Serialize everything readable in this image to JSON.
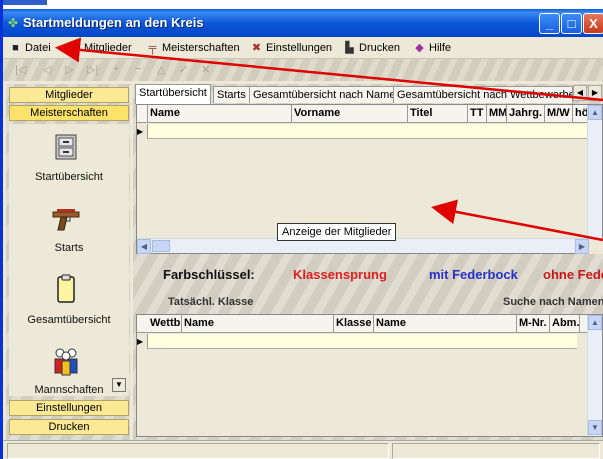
{
  "window": {
    "title": "Startmeldungen an den Kreis",
    "controls": {
      "minimize": "_",
      "maximize": "□",
      "close": "X"
    }
  },
  "menu": {
    "items": [
      {
        "label": "Datei",
        "icon": "floppy-icon"
      },
      {
        "label": "Mitglieder",
        "icon": "person-icon"
      },
      {
        "label": "Meisterschaften",
        "icon": "rifle-icon"
      },
      {
        "label": "Einstellungen",
        "icon": "tools-icon"
      },
      {
        "label": "Drucken",
        "icon": "printer-icon"
      },
      {
        "label": "Hilfe",
        "icon": "help-icon"
      }
    ]
  },
  "sidebar": {
    "headers": {
      "mitglieder": "Mitglieder",
      "meisterschaften": "Meisterschaften",
      "einstellungen": "Einstellungen",
      "drucken": "Drucken"
    },
    "items": [
      {
        "label": "Startübersicht",
        "icon": "cabinet-icon"
      },
      {
        "label": "Starts",
        "icon": "pistol-icon"
      },
      {
        "label": "Gesamtübersicht",
        "icon": "clipboard-icon"
      },
      {
        "label": "Mannschaften",
        "icon": "team-icon"
      }
    ]
  },
  "tabs": [
    {
      "label": "Startübersicht",
      "active": true
    },
    {
      "label": "Starts",
      "active": false
    },
    {
      "label": "Gesamtübersicht nach Name",
      "active": false
    },
    {
      "label": "Gesamtübersicht nach Wettbewerben",
      "active": false
    }
  ],
  "grid1": {
    "columns": [
      "Name",
      "Vorname",
      "Titel",
      "TT",
      "MM",
      "Jahrg.",
      "M/W",
      "hö"
    ]
  },
  "tooltip": "Anzeige der Mitglieder",
  "legend": {
    "label": "Farbschlüssel:",
    "items": [
      {
        "label": "Klassensprung",
        "color": "#e02020"
      },
      {
        "label": "mit Federbock",
        "color": "#2530c8"
      },
      {
        "label": "ohne Fede",
        "color": "#c81818"
      }
    ]
  },
  "subheader": {
    "left": "Tatsächl. Klasse",
    "right": "Suche nach Namen"
  },
  "grid2": {
    "columns": [
      "Wettb.",
      "Name",
      "Klasse",
      "Name",
      "M-Nr.",
      "Abm."
    ]
  },
  "colors": {
    "titlebar": "#0c58d8",
    "sidebar_header": "#fbe993",
    "row_highlight": "#ffffdf",
    "annotation_arrow": "#e00000"
  }
}
